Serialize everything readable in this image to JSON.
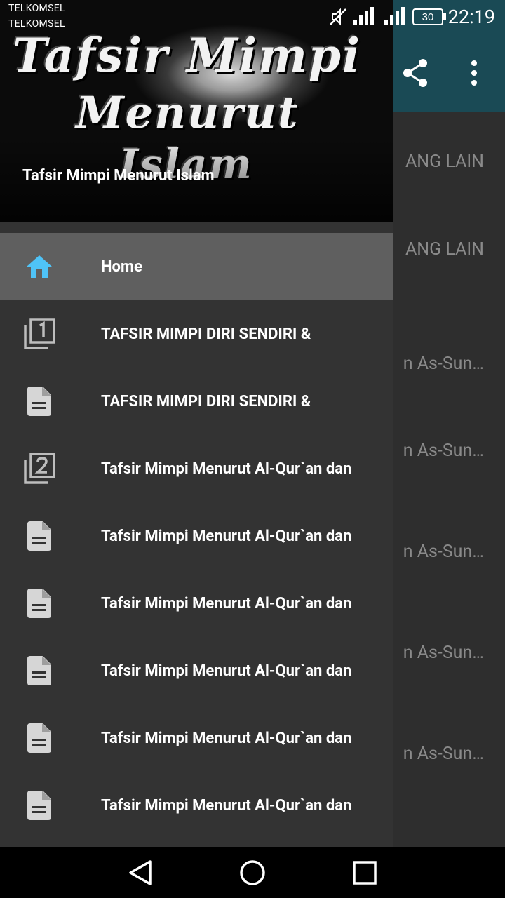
{
  "status_bar": {
    "carrier_1": "TELKOMSEL",
    "carrier_2": "TELKOMSEL",
    "battery": "30",
    "time": "22:19"
  },
  "background_list": [
    "ANG LAIN",
    "ANG LAIN",
    "n As-Sun…",
    "n As-Sun…",
    "n As-Sun…",
    "n As-Sun…",
    "n As-Sun…"
  ],
  "drawer": {
    "header_logo_lines": [
      "Tafsir Mimpi",
      "Menurut",
      "Islam"
    ],
    "header_title": "Tafsir Mimpi Menurut Islam",
    "items": [
      {
        "label": "Home",
        "icon": "home-icon"
      },
      {
        "label": "TAFSIR MIMPI DIRI SENDIRI &",
        "icon": "filter-1-icon"
      },
      {
        "label": "TAFSIR MIMPI DIRI SENDIRI &",
        "icon": "document-icon"
      },
      {
        "label": "Tafsir Mimpi Menurut Al-Qur`an dan",
        "icon": "filter-2-icon"
      },
      {
        "label": "Tafsir Mimpi Menurut Al-Qur`an dan",
        "icon": "document-icon"
      },
      {
        "label": "Tafsir Mimpi Menurut Al-Qur`an dan",
        "icon": "document-icon"
      },
      {
        "label": "Tafsir Mimpi Menurut Al-Qur`an dan",
        "icon": "document-icon"
      },
      {
        "label": "Tafsir Mimpi Menurut Al-Qur`an dan",
        "icon": "document-icon"
      },
      {
        "label": "Tafsir Mimpi Menurut Al-Qur`an dan",
        "icon": "document-icon"
      }
    ]
  },
  "colors": {
    "accent": "#4fc3f7",
    "toolbar": "#1a4a55",
    "drawer_bg": "#333333",
    "active_item_bg": "#5f5f5f"
  }
}
